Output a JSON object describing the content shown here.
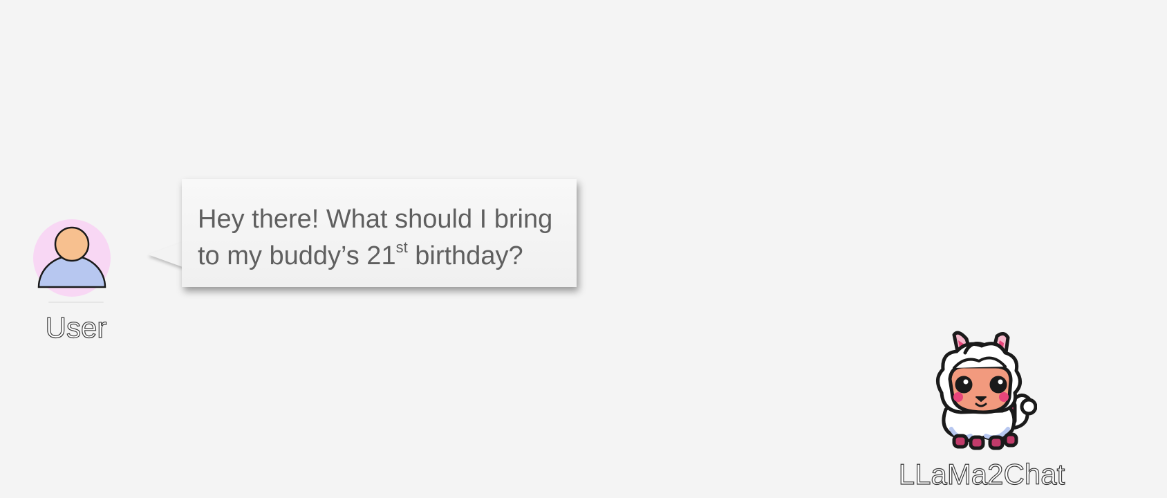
{
  "user": {
    "label": "User",
    "icon": "user-avatar-icon",
    "avatar_bg": "#f8d7f4",
    "head_color": "#f7c08f",
    "body_color": "#b7c7f0"
  },
  "message": {
    "text_before_sup": "Hey there! What should I bring to my buddy’s 21",
    "sup": "st",
    "text_after_sup": " birthday?",
    "text_color": "#5f5f5f"
  },
  "assistant": {
    "label": "LLaMa2Chat",
    "icon": "llama-avatar-icon",
    "accent": "#e8457a"
  }
}
